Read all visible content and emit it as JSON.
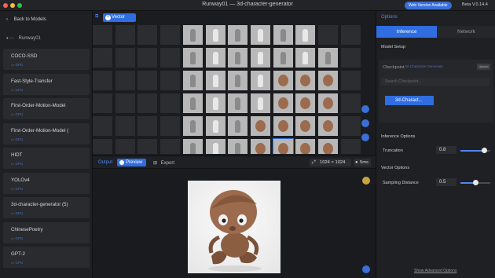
{
  "window": {
    "title": "Runway01 — 3d-character-generator",
    "web_badge": "Web Version Available",
    "beta": "Beta V.0.14.4"
  },
  "sidebar": {
    "back_label": "Back to Models",
    "workspace": "Runway01",
    "gpu_label": "GPU",
    "models": [
      "COCO-SSD",
      "Fast-Style-Transfer",
      "First-Order-Motion-Model",
      "First-Order-Motion-Model (",
      "HIDT",
      "YOLOv4",
      "3d-character-generator (5)",
      "ChinesePoetry",
      "GPT-2"
    ]
  },
  "toolbar": {
    "vector_label": "Vector"
  },
  "output": {
    "label": "Output",
    "preview_label": "Preview",
    "export_label": "Export",
    "size": "1024 × 1024",
    "time": "5ms"
  },
  "options": {
    "title": "Options",
    "tabs": [
      "Inference",
      "Network"
    ],
    "model_setup": "Model Setup",
    "checkpoint_label": "Checkpoint",
    "checkpoint_value": "3d Character Generate",
    "upload_label": "Upload",
    "search_placeholder": "Search Checkpoint...",
    "checkpoint_button": "3d-Charact...",
    "inference_options": "Inference Options",
    "truncation_label": "Truncation",
    "truncation_value": "0.8",
    "vector_options": "Vector Options",
    "sampling_label": "Sampling Distance",
    "sampling_value": "0.5",
    "advanced_link": "Show Advanced Options"
  },
  "colors": {
    "accent": "#2f6de0",
    "link": "#4f86f0"
  }
}
